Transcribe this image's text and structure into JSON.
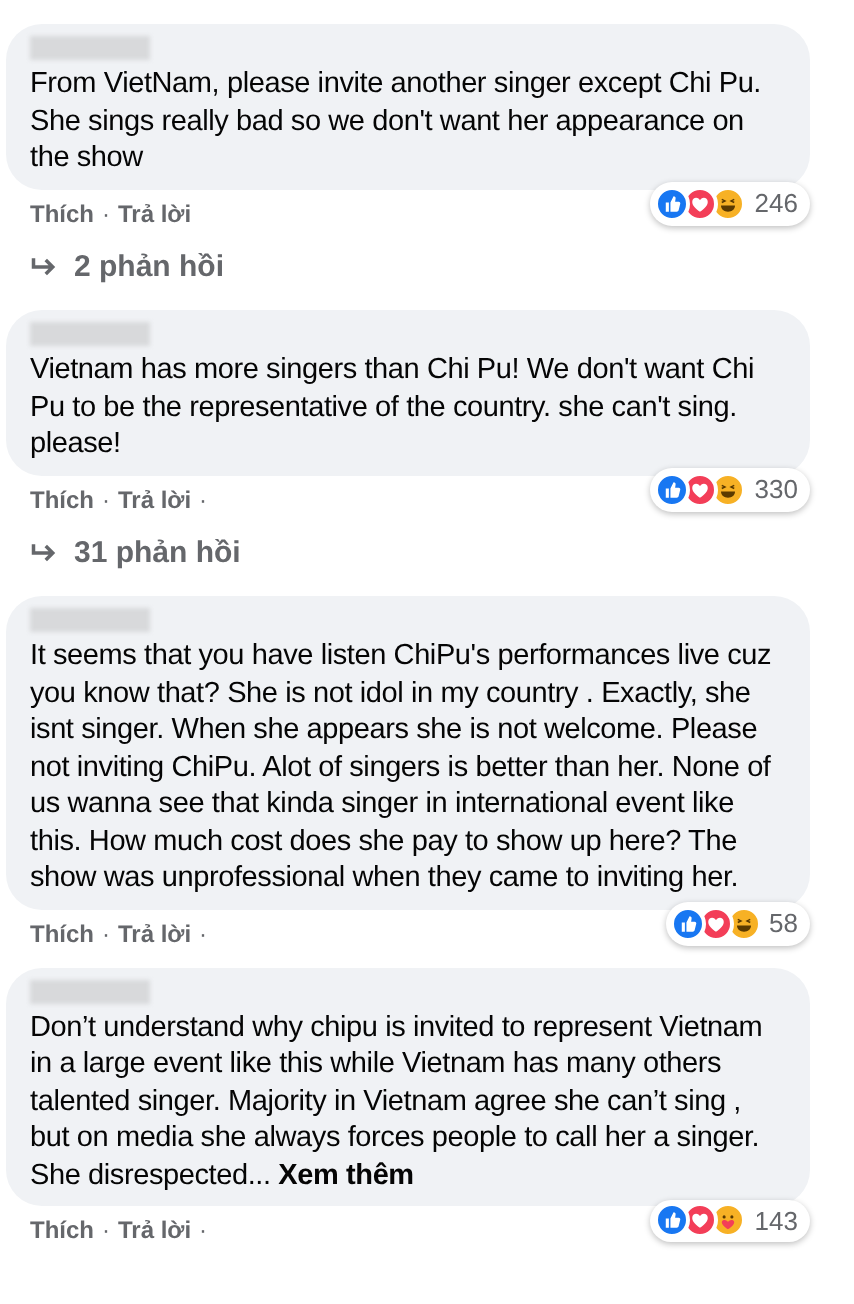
{
  "comments": [
    {
      "text": "From VietNam, please invite another singer except Chi Pu. She sings really bad so we don't want her appearance on the show",
      "reactions": [
        {
          "kind": "like"
        },
        {
          "kind": "love"
        },
        {
          "kind": "haha"
        }
      ],
      "count": "246",
      "actions": [
        "Thích",
        "Trả lời"
      ],
      "separator": "·",
      "replies": "2 phản hồi"
    },
    {
      "text": "Vietnam has more singers than Chi Pu! We don't want Chi Pu to be the representative of the country. she can't sing. please!",
      "reactions": [
        {
          "kind": "like"
        },
        {
          "kind": "love"
        },
        {
          "kind": "haha"
        }
      ],
      "count": "330",
      "actions": [
        "Thích",
        "Trả lời"
      ],
      "separator": "·",
      "trailing": "·",
      "replies": "31 phản hồi"
    },
    {
      "text": "It seems that you have listen ChiPu's performances live cuz you know that? She is not idol in my country . Exactly, she isnt singer. When she appears she is not welcome. Please not inviting ChiPu. Alot of singers is better than her. None of us wanna see that kinda singer in international event like this. How much cost does she pay to show up here? The show was unprofessional when they came to inviting her.",
      "reactions": [
        {
          "kind": "like"
        },
        {
          "kind": "love"
        },
        {
          "kind": "haha"
        }
      ],
      "count": "58",
      "actions": [
        "Thích",
        "Trả lời"
      ],
      "separator": "·",
      "trailing": "·"
    },
    {
      "text": "Don’t understand why chipu is invited to represent Vietnam in a large event like this while Vietnam has many others talented singer. Majority in Vietnam agree she can’t sing , but on media she always forces people to call her a singer. She disrespected...",
      "see_more": "Xem thêm",
      "reactions": [
        {
          "kind": "like"
        },
        {
          "kind": "love"
        },
        {
          "kind": "care"
        }
      ],
      "count": "143",
      "actions": [
        "Thích",
        "Trả lời"
      ],
      "separator": "·",
      "trailing": "·"
    }
  ]
}
